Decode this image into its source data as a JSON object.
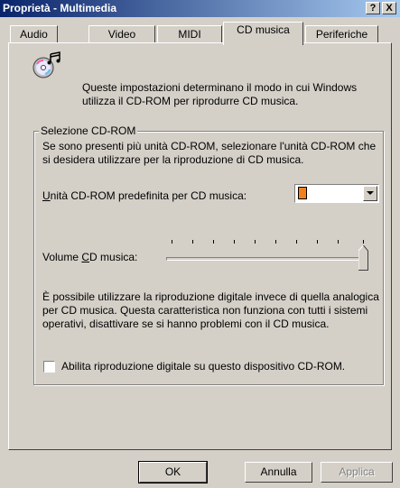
{
  "window": {
    "title": "Proprietà - Multimedia",
    "help_button": "?",
    "close_button": "X"
  },
  "tabs": [
    {
      "label": "Audio",
      "active": false
    },
    {
      "label": "Video",
      "active": false
    },
    {
      "label": "MIDI",
      "active": false
    },
    {
      "label": "CD musica",
      "active": true
    },
    {
      "label": "Periferiche",
      "active": false
    }
  ],
  "intro": {
    "icon": "cd-music-icon",
    "text": "Queste impostazioni determinano il modo in cui Windows utilizza il CD-ROM per riprodurre CD musica."
  },
  "group": {
    "label": "Selezione CD-ROM",
    "description": "Se sono presenti più unità CD-ROM, selezionare l'unità CD-ROM che si desidera utilizzare per la riproduzione di CD musica.",
    "drive_label_prefix": "U",
    "drive_label_rest": "nità CD-ROM predefinita per CD musica:",
    "volume_label_prefix": "Volume ",
    "volume_label_accel": "C",
    "volume_label_rest": "D musica:",
    "volume_level": 1.0,
    "digital_note": "È possibile utilizzare la riproduzione digitale invece di quella analogica per CD musica. Questa caratteristica non funziona con tutti i sistemi operativi, disattivare se si hanno problemi con il CD musica.",
    "checkbox_label": "Abilita riproduzione digitale su questo dispositivo CD-ROM.",
    "checkbox_checked": false
  },
  "buttons": {
    "ok": "OK",
    "cancel": "Annulla",
    "apply": "Applica"
  },
  "colors": {
    "titlebar_start": "#0a246a",
    "titlebar_end": "#a6caf0",
    "face": "#d4d0c8",
    "drive_icon": "#f08020"
  }
}
